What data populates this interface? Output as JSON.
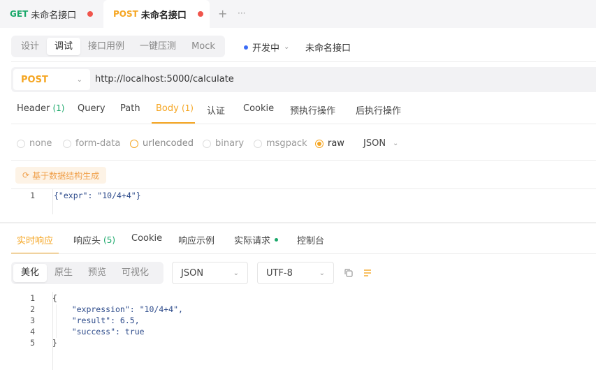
{
  "tabs": [
    {
      "method": "GET",
      "title": "未命名接口"
    },
    {
      "method": "POST",
      "title": "未命名接口"
    }
  ],
  "tab_add": "+",
  "tab_more": "···",
  "modes": [
    "设计",
    "调试",
    "接口用例",
    "一键压测",
    "Mock"
  ],
  "status": {
    "label": "开发中"
  },
  "api_name": "未命名接口",
  "request": {
    "method": "POST",
    "url": "http://localhost:5000/calculate"
  },
  "req_tabs": [
    {
      "label": "Header",
      "count": "(1)"
    },
    {
      "label": "Query",
      "count": ""
    },
    {
      "label": "Path",
      "count": ""
    },
    {
      "label": "Body",
      "count": "(1)"
    },
    {
      "label": "认证",
      "count": ""
    },
    {
      "label": "Cookie",
      "count": ""
    },
    {
      "label": "预执行操作",
      "count": ""
    },
    {
      "label": "后执行操作",
      "count": ""
    }
  ],
  "body_types": [
    "none",
    "form-data",
    "urlencoded",
    "binary",
    "msgpack",
    "raw"
  ],
  "body_format": "JSON",
  "gen_button": "基于数据结构生成",
  "request_body": {
    "line_no": "1",
    "code": "{\"expr\": \"10/4+4\"}"
  },
  "resp_tabs": [
    {
      "label": "实时响应",
      "count": ""
    },
    {
      "label": "响应头",
      "count": "(5)"
    },
    {
      "label": "Cookie",
      "count": ""
    },
    {
      "label": "响应示例",
      "count": ""
    },
    {
      "label": "实际请求",
      "count": ""
    },
    {
      "label": "控制台",
      "count": ""
    }
  ],
  "view_modes": [
    "美化",
    "原生",
    "预览",
    "可视化"
  ],
  "resp_format": "JSON",
  "resp_encoding": "UTF-8",
  "response_body": {
    "lines": [
      {
        "no": "1",
        "text": "{"
      },
      {
        "no": "2",
        "text": "    \"expression\": \"10/4+4\","
      },
      {
        "no": "3",
        "text": "    \"result\": 6.5,"
      },
      {
        "no": "4",
        "text": "    \"success\": true"
      },
      {
        "no": "5",
        "text": "}"
      }
    ]
  },
  "colors": {
    "accent": "#f5a623",
    "get": "#1aa86a",
    "dot": "#f0554c",
    "status_dot": "#3b6cf6"
  }
}
